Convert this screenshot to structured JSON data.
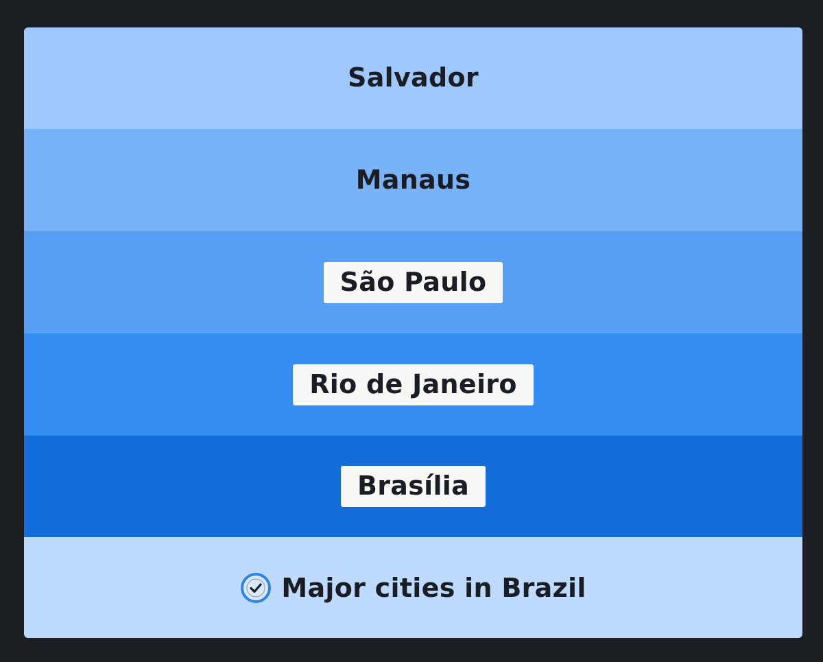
{
  "list": {
    "items": [
      {
        "label": "Salvador",
        "color": "#9fc8ff",
        "highlighted": false
      },
      {
        "label": "Manaus",
        "color": "#78b2f8",
        "highlighted": false
      },
      {
        "label": "São Paulo",
        "color": "#569ff4",
        "highlighted": true
      },
      {
        "label": "Rio de Janeiro",
        "color": "#358cf3",
        "highlighted": true
      },
      {
        "label": "Brasília",
        "color": "#136cd8",
        "highlighted": true
      }
    ],
    "footer": {
      "label": "Major cities in Brazil",
      "icon": "check-circle-icon",
      "color": "#bedbfe"
    }
  }
}
